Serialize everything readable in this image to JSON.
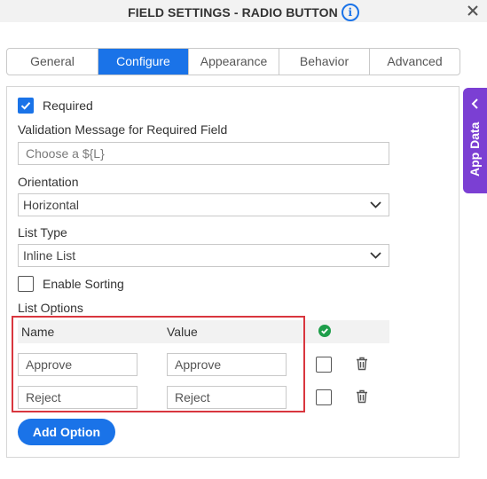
{
  "dialog": {
    "title": "FIELD SETTINGS - RADIO BUTTON",
    "info_icon": "info-icon",
    "close_icon": "close-icon"
  },
  "tabs": [
    {
      "label": "General",
      "active": false
    },
    {
      "label": "Configure",
      "active": true
    },
    {
      "label": "Appearance",
      "active": false
    },
    {
      "label": "Behavior",
      "active": false
    },
    {
      "label": "Advanced",
      "active": false
    }
  ],
  "app_data": {
    "label": "App Data",
    "icon": "chevron-left-icon"
  },
  "form": {
    "required": {
      "label": "Required",
      "checked": true
    },
    "validation_message": {
      "label": "Validation Message for Required Field",
      "placeholder": "Choose a ${L}",
      "value": ""
    },
    "orientation": {
      "label": "Orientation",
      "value": "Horizontal"
    },
    "list_type": {
      "label": "List Type",
      "value": "Inline List"
    },
    "enable_sorting": {
      "label": "Enable Sorting",
      "checked": false
    },
    "list_options": {
      "label": "List Options",
      "headers": {
        "name": "Name",
        "value": "Value"
      },
      "rows": [
        {
          "name": "Approve",
          "value": "Approve",
          "default": false
        },
        {
          "name": "Reject",
          "value": "Reject",
          "default": false
        }
      ]
    },
    "add_option_label": "Add Option"
  },
  "colors": {
    "accent": "#1a73e8",
    "app_data": "#7b3fd3",
    "highlight": "#d9363e",
    "check_green": "#1e9e4a"
  }
}
